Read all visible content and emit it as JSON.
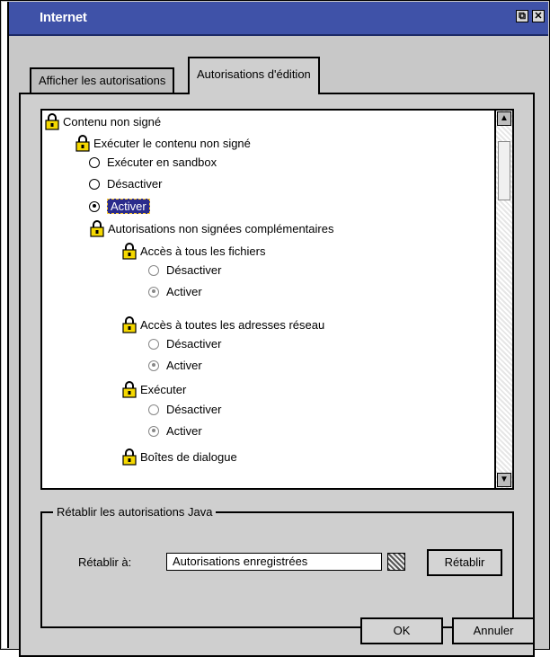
{
  "window": {
    "title": "Internet"
  },
  "tabs": [
    {
      "label": "Afficher les autorisations"
    },
    {
      "label": "Autorisations d'édition"
    }
  ],
  "tree": [
    {
      "kind": "lock",
      "label": "Contenu non signé"
    },
    {
      "kind": "lock",
      "label": "Exécuter le contenu non signé"
    },
    {
      "kind": "radio",
      "label": "Exécuter en sandbox",
      "checked": false
    },
    {
      "kind": "radio",
      "label": "Désactiver",
      "checked": false
    },
    {
      "kind": "radio",
      "label": "Activer",
      "checked": true,
      "selected": true
    },
    {
      "kind": "lock",
      "label": "Autorisations non signées complémentaires"
    },
    {
      "kind": "lock",
      "label": "Accès à tous les fichiers"
    },
    {
      "kind": "radio",
      "label": "Désactiver",
      "checked": false
    },
    {
      "kind": "radio",
      "label": "Activer",
      "checked": true
    },
    {
      "kind": "lock",
      "label": "Accès à toutes les adresses réseau"
    },
    {
      "kind": "radio",
      "label": "Désactiver",
      "checked": false
    },
    {
      "kind": "radio",
      "label": "Activer",
      "checked": true
    },
    {
      "kind": "lock",
      "label": "Exécuter"
    },
    {
      "kind": "radio",
      "label": "Désactiver",
      "checked": false
    },
    {
      "kind": "radio",
      "label": "Activer",
      "checked": true
    },
    {
      "kind": "lock",
      "label": "Boîtes de dialogue"
    }
  ],
  "reset_group": {
    "title": "Rétablir les autorisations Java",
    "label": "Rétablir à:",
    "value": "Autorisations enregistrées",
    "button": "Rétablir"
  },
  "buttons": {
    "ok": "OK",
    "cancel": "Annuler"
  }
}
